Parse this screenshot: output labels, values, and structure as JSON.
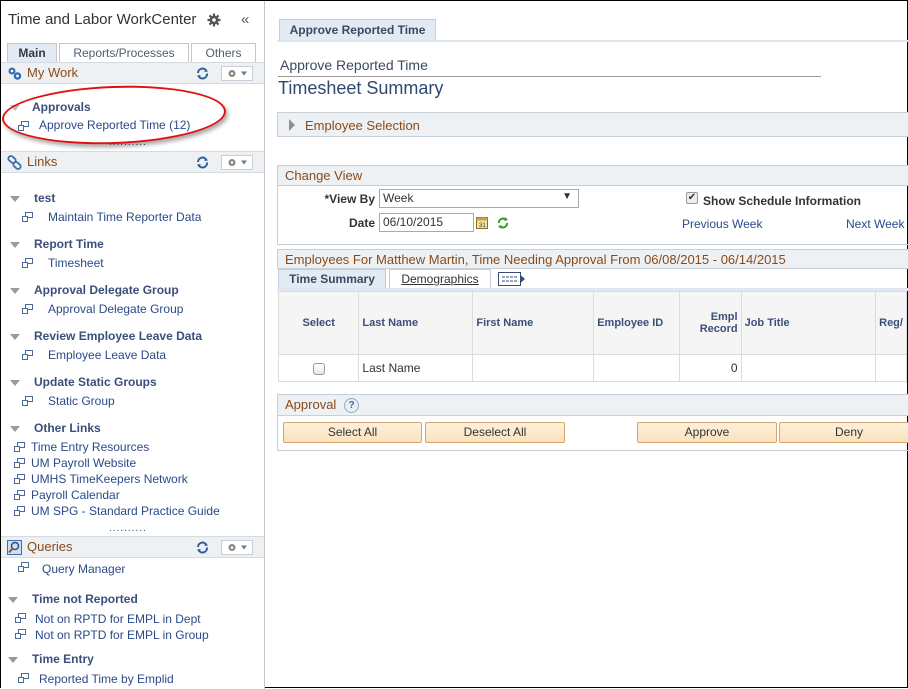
{
  "workcenter": {
    "title": "Time and Labor WorkCenter",
    "collapse_label": "«",
    "tabs": [
      {
        "label": "Main",
        "active": true
      },
      {
        "label": "Reports/Processes",
        "active": false
      },
      {
        "label": "Others",
        "active": false
      }
    ],
    "my_work": {
      "title": "My Work",
      "groups": [
        {
          "label": "Approvals",
          "items": [
            {
              "label": "Approve Reported Time (12)"
            }
          ]
        }
      ]
    },
    "links": {
      "title": "Links",
      "groups": [
        {
          "label": "test",
          "items": [
            {
              "label": "Maintain Time Reporter Data"
            }
          ]
        },
        {
          "label": "Report Time",
          "items": [
            {
              "label": "Timesheet"
            }
          ]
        },
        {
          "label": "Approval Delegate Group",
          "items": [
            {
              "label": "Approval Delegate Group"
            }
          ]
        },
        {
          "label": "Review Employee Leave Data",
          "items": [
            {
              "label": "Employee Leave Data"
            }
          ]
        },
        {
          "label": "Update Static Groups",
          "items": [
            {
              "label": "Static Group"
            }
          ]
        },
        {
          "label": "Other Links",
          "items": [
            {
              "label": "Time Entry Resources"
            },
            {
              "label": "UM Payroll Website"
            },
            {
              "label": "UMHS TimeKeepers Network"
            },
            {
              "label": "Payroll Calendar"
            },
            {
              "label": "UM SPG - Standard Practice Guide"
            }
          ]
        }
      ]
    },
    "queries": {
      "title": "Queries",
      "top_item": "Query Manager",
      "groups": [
        {
          "label": "Time not Reported",
          "items": [
            {
              "label": "Not on RPTD for EMPL in Dept"
            },
            {
              "label": "Not on RPTD for EMPL in Group"
            }
          ]
        },
        {
          "label": "Time Entry",
          "items": [
            {
              "label": "Reported Time by Emplid"
            }
          ]
        }
      ]
    },
    "separator": "..........",
    "highlight_color": "#e01010"
  },
  "main": {
    "page_tab": "Approve Reported Time",
    "subtitle": "Approve Reported Time",
    "title": "Timesheet Summary",
    "employee_selection": "Employee Selection",
    "change_view": {
      "title": "Change View",
      "view_by_label": "*View By",
      "view_by_value": "Week",
      "date_label": "Date",
      "date_value": "06/10/2015",
      "show_schedule_label": "Show Schedule Information",
      "show_schedule_checked": true,
      "previous_week": "Previous Week",
      "next_week": "Next Week"
    },
    "employees_header": "Employees For Matthew Martin, Time Needing Approval From 06/08/2015 - 06/14/2015",
    "grid_tabs": [
      {
        "label": "Time Summary",
        "active": true
      },
      {
        "label": "Demographics",
        "active": false
      }
    ],
    "grid": {
      "columns": [
        "Select",
        "Last Name",
        "First Name",
        "Employee ID",
        "Empl Record",
        "Job Title",
        "Reg/"
      ],
      "rows": [
        {
          "select": false,
          "last_name": "Last Name",
          "first_name": "",
          "employee_id": "",
          "empl_record": "0",
          "job_title": "",
          "reg": ""
        }
      ]
    },
    "approval": {
      "title": "Approval",
      "select_all": "Select All",
      "deselect_all": "Deselect All",
      "approve": "Approve",
      "deny": "Deny"
    }
  }
}
